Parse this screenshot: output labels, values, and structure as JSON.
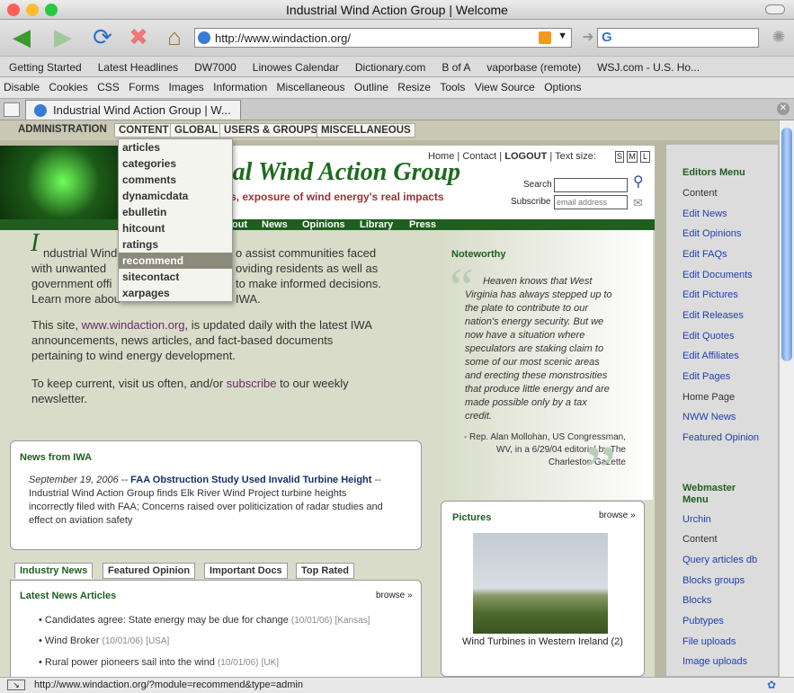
{
  "window": {
    "title": "Industrial Wind Action Group | Welcome"
  },
  "nav": {
    "url": "http://www.windaction.org/"
  },
  "bookmarks": [
    "Getting Started",
    "Latest Headlines",
    "DW7000",
    "Linowes Calendar",
    "Dictionary.com",
    "B of A",
    "vaporbase (remote)",
    "WSJ.com - U.S. Ho..."
  ],
  "devbar": [
    "Disable",
    "Cookies",
    "CSS",
    "Forms",
    "Images",
    "Information",
    "Miscellaneous",
    "Outline",
    "Resize",
    "Tools",
    "View Source",
    "Options"
  ],
  "tab": {
    "title": "Industrial Wind Action Group | W..."
  },
  "admin": {
    "label": "ADMINISTRATION",
    "menus": [
      "CONTENT",
      "GLOBAL",
      "USERS & GROUPS",
      "MISCELLANEOUS"
    ]
  },
  "dropdown": [
    "articles",
    "categories",
    "comments",
    "dynamicdata",
    "ebulletin",
    "hitcount",
    "ratings",
    "recommend",
    "sitecontact",
    "xarpages"
  ],
  "header": {
    "title": "rial Wind Action Group",
    "tagline": "s, exposure of wind energy's real impacts",
    "links": [
      "Home",
      "Contact",
      "LOGOUT"
    ],
    "textsize": "Text size:",
    "sizes": [
      "S",
      "M",
      "L"
    ],
    "search_label": "Search",
    "subscribe_label": "Subscribe",
    "email_placeholder": "email address"
  },
  "greennav": [
    "out",
    "News",
    "Opinions",
    "Library",
    "Press"
  ],
  "intro": {
    "p1a": "ndustrial Wind",
    "p1b": "o assist communities faced",
    "p1c": "with unwanted",
    "p1d": "oviding residents as well as",
    "p1e": "government offi",
    "p1f": "to make informed decisions.",
    "p1g": "Learn more abou",
    "p1h": "IWA.",
    "dropcap": "I",
    "p2": "This site,",
    "p2link": "www.windaction.org",
    "p2b": ", is updated daily with the latest IWA",
    "p2c": "announcements, news articles, and fact-based documents",
    "p2d": "pertaining to wind energy development.",
    "p3": "To keep current, visit us often, and/or",
    "p3link": "subscribe",
    "p3b": "to our weekly",
    "p3c": "newsletter."
  },
  "news": {
    "heading": "News from IWA",
    "date": "September 19, 2006 --",
    "headline": "FAA Obstruction Study Used Invalid Turbine Height",
    "dash": "--",
    "body1": "Industrial Wind Action Group finds Elk River Wind Project turbine heights",
    "body2": "incorrectly filed with FAA; Concerns raised over politicization of radar studies and",
    "body3": "effect on aviation safety"
  },
  "tabs": [
    "Industry News",
    "Featured Opinion",
    "Important Docs",
    "Top Rated"
  ],
  "latest": {
    "heading": "Latest News Articles",
    "browse": "browse »",
    "items": [
      {
        "title": "Candidates agree: State energy may be due for change",
        "date": "(10/01/06)",
        "tag": "[Kansas]"
      },
      {
        "title": "Wind Broker",
        "date": "(10/01/06)",
        "tag": "[USA]"
      },
      {
        "title": "Rural power pioneers sail into the wind",
        "date": "(10/01/06)",
        "tag": "[UK]"
      }
    ]
  },
  "noteworthy": {
    "heading": "Noteworthy",
    "quote": [
      "Heaven knows that West",
      "Virginia has always stepped up to",
      "the plate to contribute to our",
      "nation's energy security. But we",
      "now have a situation where",
      "speculators are staking claim to",
      "some of our most scenic areas",
      "and erecting these monstrosities",
      "that produce little energy and are",
      "made possible only by a tax",
      "credit."
    ],
    "attribution": [
      "- Rep. Alan Mollohan, US Congressman,",
      "WV, in a 6/29/04 editorial by The",
      "Charleston Gazette"
    ]
  },
  "pictures": {
    "heading": "Pictures",
    "browse": "browse »",
    "caption": "Wind Turbines in Western Ireland (2)"
  },
  "editors": {
    "heading": "Editors Menu",
    "items": [
      {
        "t": "Content",
        "link": false
      },
      {
        "t": "Edit News",
        "link": true
      },
      {
        "t": "Edit Opinions",
        "link": true
      },
      {
        "t": "Edit FAQs",
        "link": true
      },
      {
        "t": "Edit Documents",
        "link": true
      },
      {
        "t": "Edit Pictures",
        "link": true
      },
      {
        "t": "Edit Releases",
        "link": true
      },
      {
        "t": "Edit Quotes",
        "link": true
      },
      {
        "t": "Edit Affiliates",
        "link": true
      },
      {
        "t": "Edit Pages",
        "link": true
      },
      {
        "t": "Home Page",
        "link": false
      },
      {
        "t": "NWW News",
        "link": true
      },
      {
        "t": "Featured Opinion",
        "link": true
      }
    ]
  },
  "webmaster": {
    "heading1": "Webmaster",
    "heading2": "Menu",
    "items": [
      {
        "t": "Urchin",
        "link": true
      },
      {
        "t": "Content",
        "link": false
      },
      {
        "t": "Query articles db",
        "link": true
      },
      {
        "t": "Blocks groups",
        "link": true
      },
      {
        "t": "Blocks",
        "link": true
      },
      {
        "t": "Pubtypes",
        "link": true
      },
      {
        "t": "File uploads",
        "link": true
      },
      {
        "t": "Image uploads",
        "link": true
      }
    ]
  },
  "status": {
    "text": "http://www.windaction.org/?module=recommend&type=admin"
  }
}
